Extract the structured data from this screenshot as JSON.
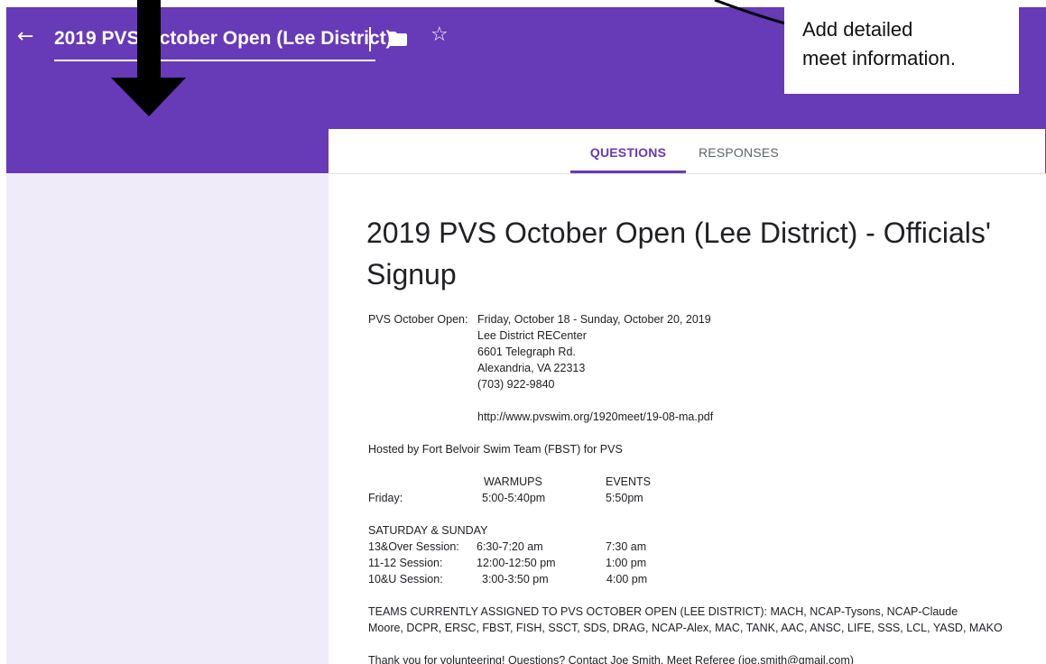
{
  "header": {
    "title": "2019 PVS October Open (Lee District)",
    "back_icon": "arrow-left-icon",
    "folder_icon": "folder-icon",
    "star_icon": "star-outline-icon",
    "bg_color": "#673ab7"
  },
  "tabs": [
    {
      "label": "QUESTIONS",
      "active": true
    },
    {
      "label": "RESPONSES",
      "active": false
    }
  ],
  "form": {
    "title": "2019 PVS October Open (Lee District) - Officials' Signup",
    "meet": {
      "label": "PVS October Open:",
      "lines": [
        "Friday, October 18 - Sunday, October 20, 2019",
        "Lee District RECenter",
        "6601 Telegraph Rd.",
        "Alexandria, VA 22313",
        "(703) 922-9840"
      ],
      "url": "http://www.pvswim.org/1920meet/19-08-ma.pdf"
    },
    "hosted": "Hosted by Fort Belvoir Swim Team (FBST) for PVS",
    "schedule": {
      "col_warmups": "WARMUPS",
      "col_events": "EVENTS",
      "friday": {
        "label": "Friday:",
        "warmups": "5:00-5:40pm",
        "events": "5:50pm"
      },
      "weekend_heading": "SATURDAY & SUNDAY",
      "sessions": [
        {
          "label": "13&Over Session:",
          "warmups": "6:30-7:20 am",
          "events": "7:30 am"
        },
        {
          "label": "11-12 Session:",
          "warmups": "12:00-12:50 pm",
          "events": "1:00 pm"
        },
        {
          "label": "10&U Session:",
          "warmups": "3:00-3:50 pm",
          "events": "4:00 pm"
        }
      ]
    },
    "teams_line1": "TEAMS CURRENTLY ASSIGNED TO PVS OCTOBER OPEN (LEE DISTRICT):   MACH, NCAP-Tysons, NCAP-Claude",
    "teams_line2": "Moore, DCPR, ERSC, FBST, FISH, SSCT, SDS, DRAG, NCAP-Alex, MAC, TANK, AAC, ANSC, LIFE, SSS, LCL, YASD,  MAKO",
    "thanks": "Thank you for volunteering!  Questions?  Contact Joe Smith, Meet Referee (joe.smith@gmail.com)"
  },
  "callout": {
    "line1": "Add detailed",
    "line2": "meet information."
  }
}
